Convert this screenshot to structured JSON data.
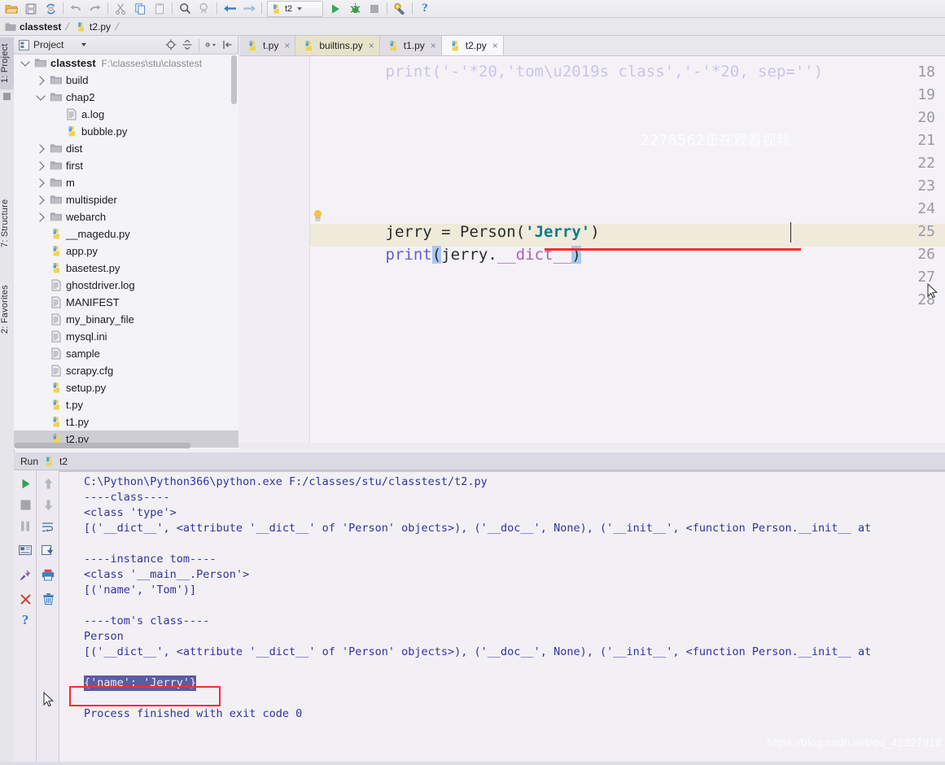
{
  "toolbar": {
    "icons": [
      {
        "name": "open-folder-icon",
        "glyph": "folder"
      },
      {
        "name": "save-icon",
        "glyph": "save"
      },
      {
        "name": "sync-icon",
        "glyph": "sync"
      },
      {
        "name": "undo-icon",
        "glyph": "undo"
      },
      {
        "name": "redo-icon",
        "glyph": "redo"
      },
      {
        "name": "cut-icon",
        "glyph": "cut"
      },
      {
        "name": "copy-icon",
        "glyph": "copy"
      },
      {
        "name": "paste-icon",
        "glyph": "paste"
      },
      {
        "name": "find-icon",
        "glyph": "find"
      },
      {
        "name": "find-structural-icon",
        "glyph": "findstruct"
      },
      {
        "name": "back-icon",
        "glyph": "back"
      },
      {
        "name": "forward-icon",
        "glyph": "forward"
      }
    ],
    "run_config": "t2",
    "run_label": "Run",
    "debug_label": "Debug",
    "stop_label": "Stop",
    "settings_label": "Settings",
    "help_label": "Help"
  },
  "breadcrumb": {
    "project": "classtest",
    "file": "t2.py"
  },
  "left_strips": {
    "project_tab": "1: Project",
    "structure_tab": "7: Structure",
    "favorites_tab": "2: Favorites"
  },
  "project_panel": {
    "title": "Project",
    "header_icons": [
      "locate-icon",
      "collapse-icon",
      "gear-icon",
      "hide-icon"
    ],
    "tree": [
      {
        "label": "classtest",
        "path": "F:\\classes\\stu\\classtest",
        "indent": 0,
        "twisty": "open",
        "icon": "folder",
        "bold": true,
        "selected": false
      },
      {
        "label": "build",
        "path": "",
        "indent": 1,
        "twisty": "closed",
        "icon": "folder",
        "bold": false,
        "selected": false
      },
      {
        "label": "chap2",
        "path": "",
        "indent": 1,
        "twisty": "open",
        "icon": "folder",
        "bold": false,
        "selected": false
      },
      {
        "label": "a.log",
        "path": "",
        "indent": 2,
        "twisty": "none",
        "icon": "file",
        "bold": false,
        "selected": false
      },
      {
        "label": "bubble.py",
        "path": "",
        "indent": 2,
        "twisty": "none",
        "icon": "python",
        "bold": false,
        "selected": false
      },
      {
        "label": "dist",
        "path": "",
        "indent": 1,
        "twisty": "closed",
        "icon": "folder",
        "bold": false,
        "selected": false
      },
      {
        "label": "first",
        "path": "",
        "indent": 1,
        "twisty": "closed",
        "icon": "folder",
        "bold": false,
        "selected": false
      },
      {
        "label": "m",
        "path": "",
        "indent": 1,
        "twisty": "closed",
        "icon": "folder",
        "bold": false,
        "selected": false
      },
      {
        "label": "multispider",
        "path": "",
        "indent": 1,
        "twisty": "closed",
        "icon": "folder",
        "bold": false,
        "selected": false
      },
      {
        "label": "webarch",
        "path": "",
        "indent": 1,
        "twisty": "closed",
        "icon": "folder",
        "bold": false,
        "selected": false
      },
      {
        "label": "__magedu.py",
        "path": "",
        "indent": 1,
        "twisty": "none",
        "icon": "python",
        "bold": false,
        "selected": false
      },
      {
        "label": "app.py",
        "path": "",
        "indent": 1,
        "twisty": "none",
        "icon": "python",
        "bold": false,
        "selected": false
      },
      {
        "label": "basetest.py",
        "path": "",
        "indent": 1,
        "twisty": "none",
        "icon": "python",
        "bold": false,
        "selected": false
      },
      {
        "label": "ghostdriver.log",
        "path": "",
        "indent": 1,
        "twisty": "none",
        "icon": "file",
        "bold": false,
        "selected": false
      },
      {
        "label": "MANIFEST",
        "path": "",
        "indent": 1,
        "twisty": "none",
        "icon": "file",
        "bold": false,
        "selected": false
      },
      {
        "label": "my_binary_file",
        "path": "",
        "indent": 1,
        "twisty": "none",
        "icon": "file",
        "bold": false,
        "selected": false
      },
      {
        "label": "mysql.ini",
        "path": "",
        "indent": 1,
        "twisty": "none",
        "icon": "file",
        "bold": false,
        "selected": false
      },
      {
        "label": "sample",
        "path": "",
        "indent": 1,
        "twisty": "none",
        "icon": "file",
        "bold": false,
        "selected": false
      },
      {
        "label": "scrapy.cfg",
        "path": "",
        "indent": 1,
        "twisty": "none",
        "icon": "file",
        "bold": false,
        "selected": false
      },
      {
        "label": "setup.py",
        "path": "",
        "indent": 1,
        "twisty": "none",
        "icon": "python",
        "bold": false,
        "selected": false
      },
      {
        "label": "t.py",
        "path": "",
        "indent": 1,
        "twisty": "none",
        "icon": "python",
        "bold": false,
        "selected": false
      },
      {
        "label": "t1.py",
        "path": "",
        "indent": 1,
        "twisty": "none",
        "icon": "python",
        "bold": false,
        "selected": false
      },
      {
        "label": "t2.py",
        "path": "",
        "indent": 1,
        "twisty": "none",
        "icon": "python",
        "bold": false,
        "selected": true
      }
    ]
  },
  "editor": {
    "tabs": [
      {
        "label": "t.py",
        "state": "normal",
        "icon": "python"
      },
      {
        "label": "builtins.py",
        "state": "highlighted",
        "icon": "python"
      },
      {
        "label": "t1.py",
        "state": "normal",
        "icon": "python"
      },
      {
        "label": "t2.py",
        "state": "active",
        "icon": "python"
      }
    ],
    "line_numbers": [
      "18",
      "19",
      "20",
      "21",
      "22",
      "23",
      "24",
      "25",
      "26",
      "27",
      "28"
    ],
    "code": {
      "line22": {
        "var": "jerry",
        "eq": " = ",
        "cls": "Person",
        "openparen": "(",
        "quote1": "'",
        "str": "Jerry",
        "quote2": "'",
        "closeparen": ")"
      },
      "line23": {
        "fn": "print",
        "openparen": "(",
        "obj": "jerry.",
        "dunder": "__dict__",
        "closeparen": ")"
      }
    },
    "chinese_watermark": "2278562正在观看视频",
    "current_line": 23
  },
  "run_panel": {
    "tab_label": "Run",
    "tab_name": "t2",
    "left_icons": [
      "run-icon",
      "stop-icon",
      "pause-icon",
      "layout-icon",
      "pin-icon",
      "close-icon",
      "help-icon"
    ],
    "right_icons": [
      "up-arrow-icon",
      "down-arrow-icon",
      "soft-wrap-icon",
      "scroll-to-end-icon",
      "print-icon",
      "trash-icon"
    ],
    "console": [
      {
        "text": "C:\\Python\\Python366\\python.exe F:/classes/stu/classtest/t2.py",
        "selected": false
      },
      {
        "text": "----class----",
        "selected": false
      },
      {
        "text": "<class 'type'>",
        "selected": false
      },
      {
        "text": "[('__dict__', <attribute '__dict__' of 'Person' objects>), ('__doc__', None), ('__init__', <function Person.__init__ at",
        "selected": false
      },
      {
        "text": "",
        "selected": false
      },
      {
        "text": "----instance tom----",
        "selected": false
      },
      {
        "text": "<class '__main__.Person'>",
        "selected": false
      },
      {
        "text": "[('name', 'Tom')]",
        "selected": false
      },
      {
        "text": "",
        "selected": false
      },
      {
        "text": "----tom's class----",
        "selected": false
      },
      {
        "text": "Person",
        "selected": false
      },
      {
        "text": "[('__dict__', <attribute '__dict__' of 'Person' objects>), ('__doc__', None), ('__init__', <function Person.__init__ at",
        "selected": false
      },
      {
        "text": "",
        "selected": false
      },
      {
        "text": "{'name': 'Jerry'}",
        "selected": true
      },
      {
        "text": "",
        "selected": false
      },
      {
        "text": "Process finished with exit code 0",
        "selected": false
      }
    ]
  },
  "watermark": {
    "url": "https://blog.csdn.net/qq_42227818"
  },
  "colors": {
    "accent_red": "#fb2c2c",
    "selection_blue": "#a8c8f0",
    "console_text": "#32329e",
    "console_selection": "#5b5ba6",
    "string_teal": "#117a8b",
    "dunder_purple": "#b05fb0",
    "function_purple": "#6c5ac7",
    "current_line": "#f0eadb"
  }
}
